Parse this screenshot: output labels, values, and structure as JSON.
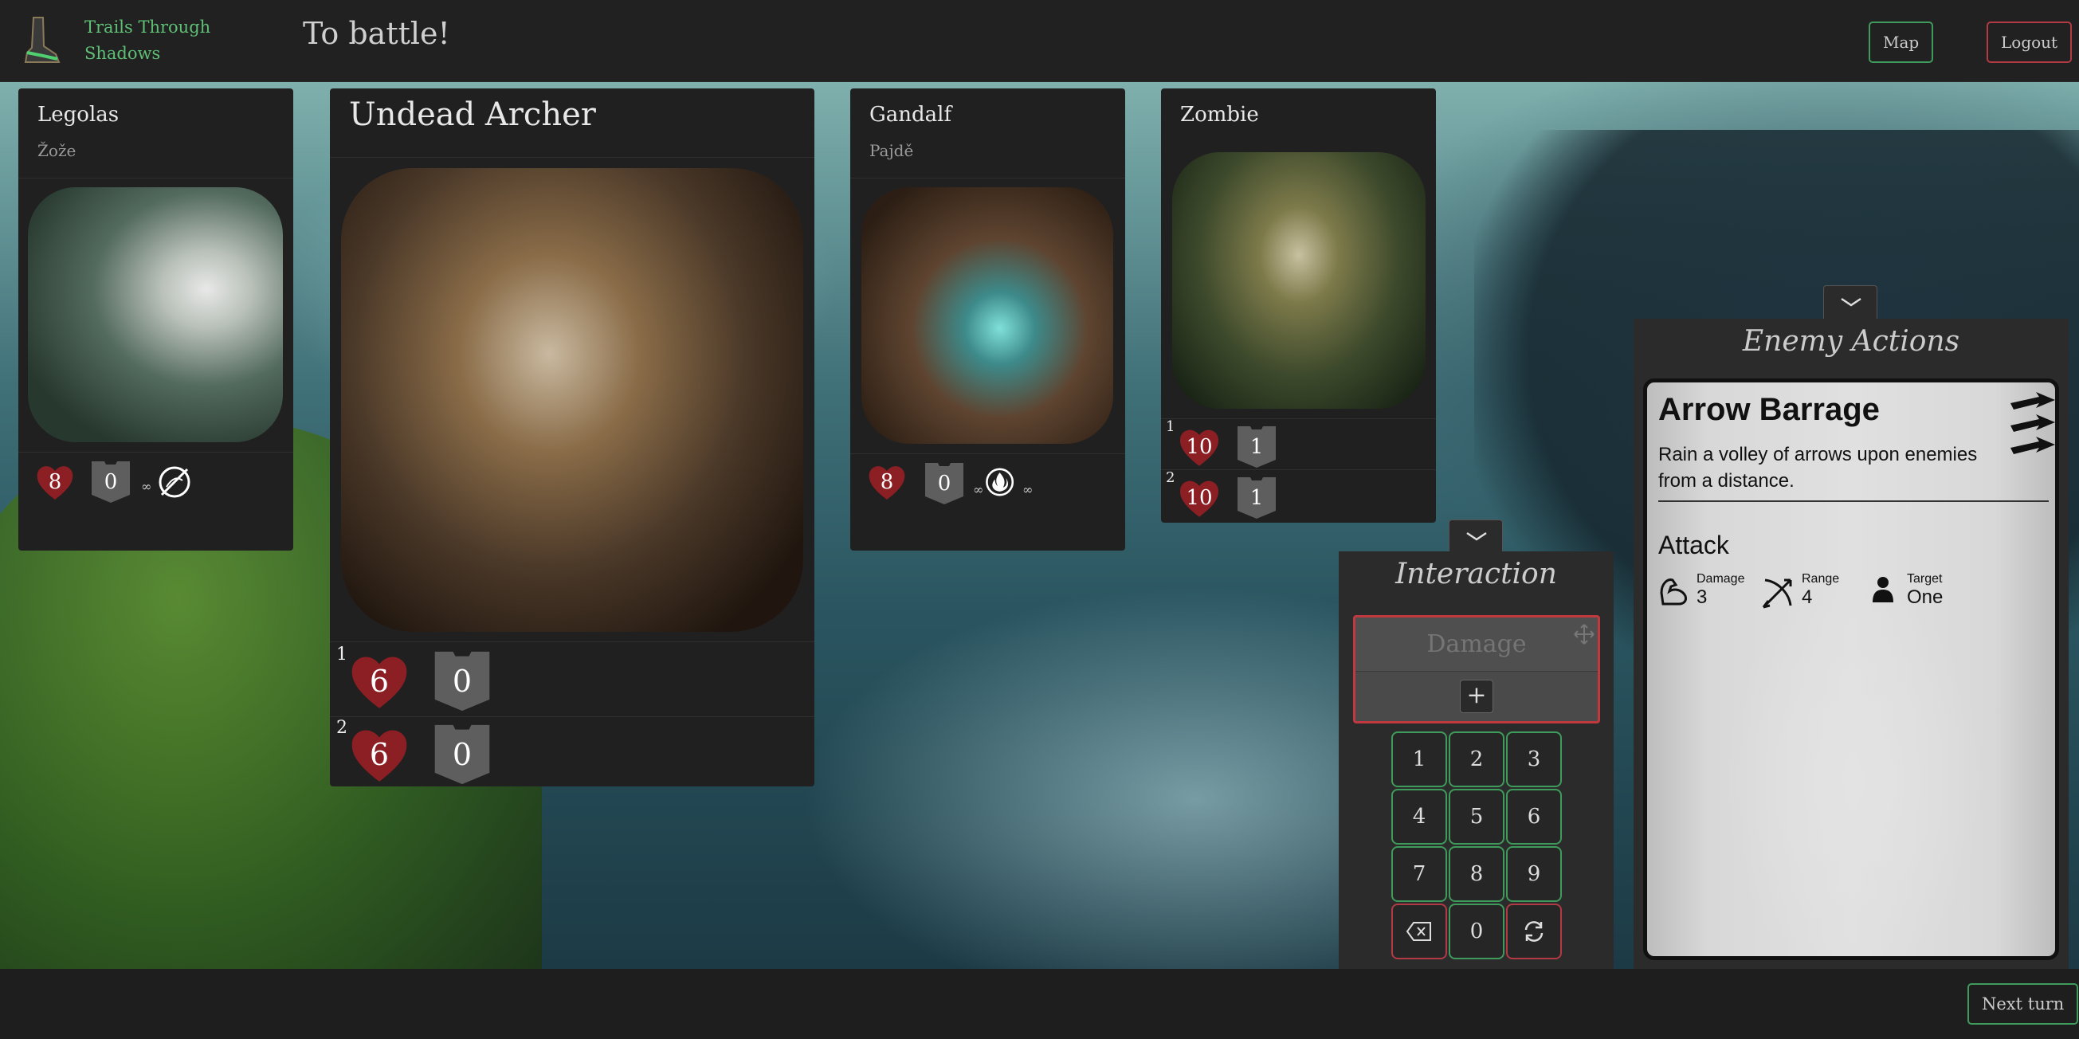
{
  "header": {
    "brand": "Trails Through Shadows",
    "title": "To battle!",
    "map_label": "Map",
    "logout_label": "Logout"
  },
  "characters": [
    {
      "name": "Legolas",
      "player": "Žože",
      "health": "8",
      "armor": "0",
      "condition_icon": "bound-icon",
      "condition_suffix": "∞"
    },
    {
      "name": "Gandalf",
      "player": "Pajdě",
      "health": "8",
      "armor": "0",
      "condition_icon": "flame-icon",
      "condition_prefix": "∞",
      "condition_suffix": "∞"
    }
  ],
  "enemies": {
    "undead_archer": {
      "name": "Undead Archer",
      "units": [
        {
          "number": "1",
          "health": "6",
          "armor": "0"
        },
        {
          "number": "2",
          "health": "6",
          "armor": "0"
        }
      ]
    },
    "zombie": {
      "name": "Zombie",
      "units": [
        {
          "number": "1",
          "health": "10",
          "armor": "1"
        },
        {
          "number": "2",
          "health": "10",
          "armor": "1"
        }
      ]
    }
  },
  "interaction": {
    "title": "Interaction",
    "damage_placeholder": "Damage",
    "plus": "+",
    "keys": [
      "1",
      "2",
      "3",
      "4",
      "5",
      "6",
      "7",
      "8",
      "9"
    ],
    "zero": "0",
    "backspace_icon": "backspace-icon",
    "reset_icon": "refresh-icon"
  },
  "enemy_actions": {
    "title": "Enemy Actions",
    "card": {
      "name": "Arrow Barrage",
      "description": "Rain a volley of arrows upon enemies from a distance.",
      "action_type": "Attack",
      "stats": [
        {
          "icon": "bicep-icon",
          "label": "Damage",
          "value": "3"
        },
        {
          "icon": "bow-icon",
          "label": "Range",
          "value": "4"
        },
        {
          "icon": "person-icon",
          "label": "Target",
          "value": "One"
        }
      ]
    }
  },
  "footer": {
    "next_turn": "Next turn"
  },
  "colors": {
    "health": "#8c1f24",
    "armor": "#5e5e5e",
    "accent_green": "#3f9b5c",
    "accent_red": "#b23a44"
  }
}
